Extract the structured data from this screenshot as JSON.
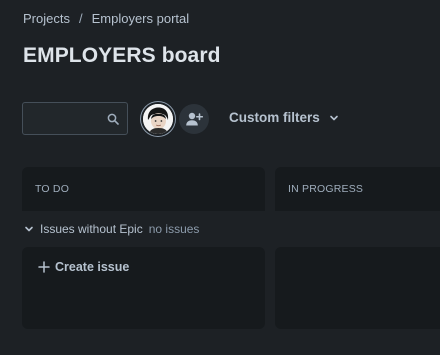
{
  "breadcrumb": {
    "items": [
      "Projects",
      "Employers portal"
    ],
    "separator": "/"
  },
  "page": {
    "title": "EMPLOYERS board"
  },
  "toolbar": {
    "search": {
      "value": "",
      "placeholder": ""
    },
    "custom_filters_label": "Custom filters",
    "icons": [
      "search-icon",
      "avatar",
      "add-people-icon",
      "chevron-down-icon"
    ]
  },
  "board": {
    "columns": [
      {
        "label": "TO DO"
      },
      {
        "label": "IN PROGRESS"
      }
    ],
    "swimlane": {
      "title": "Issues without Epic",
      "count_text": "no issues",
      "expanded": true
    },
    "create_issue_label": "Create issue"
  },
  "colors": {
    "background": "#1d2125",
    "column": "#161a1d",
    "text": "#b6c2cf",
    "title": "#dee4ea",
    "muted": "#8c9bab"
  }
}
